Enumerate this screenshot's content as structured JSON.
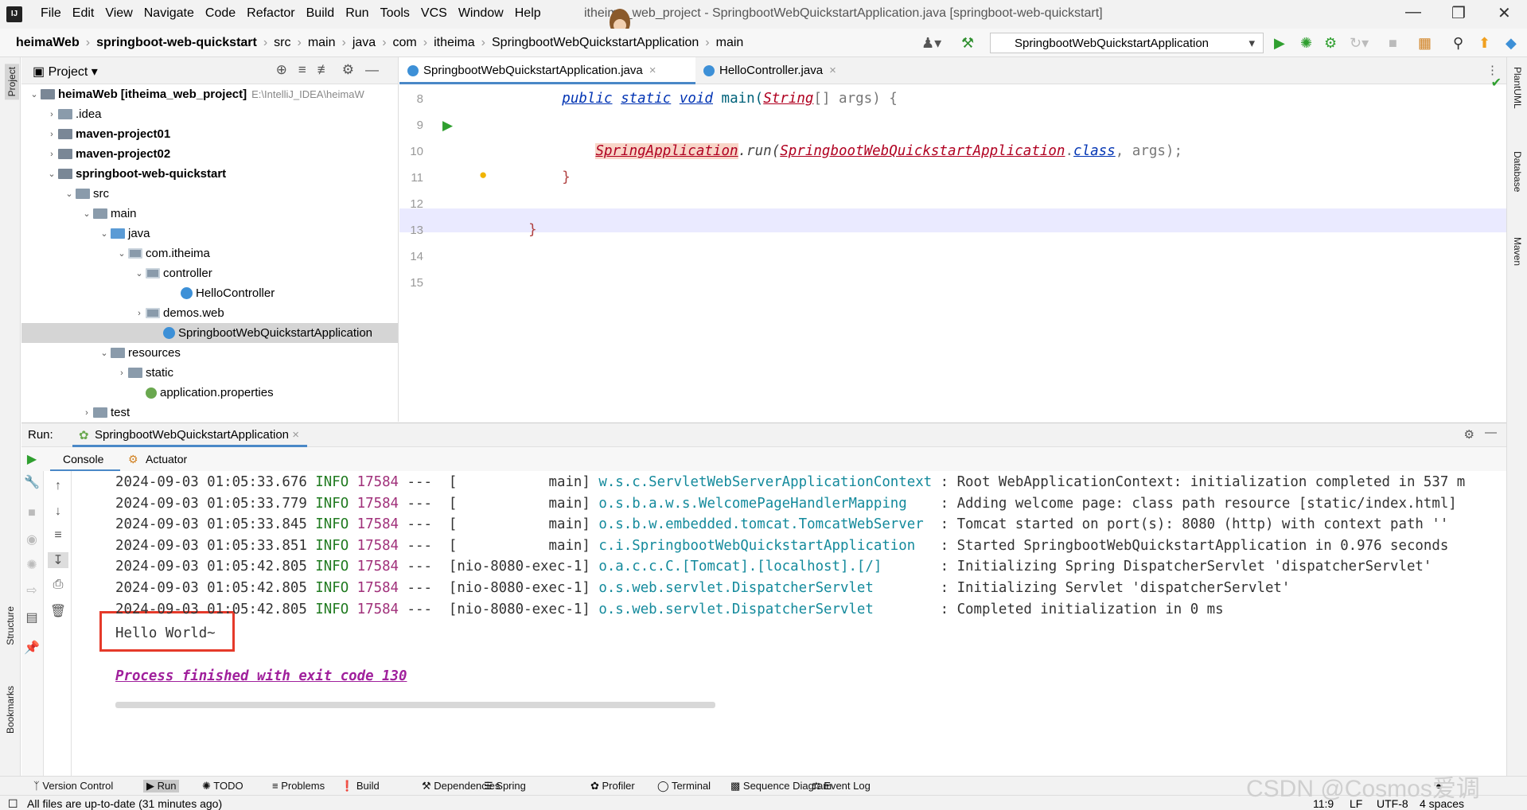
{
  "menubar": {
    "items": [
      "File",
      "Edit",
      "View",
      "Navigate",
      "Code",
      "Refactor",
      "Build",
      "Run",
      "Tools",
      "VCS",
      "Window",
      "Help"
    ],
    "window_title": "itheima_web_project - SpringbootWebQuickstartApplication.java [springboot-web-quickstart]"
  },
  "navbar": {
    "crumbs": [
      "heimaWeb",
      "springboot-web-quickstart",
      "src",
      "main",
      "java",
      "com",
      "itheima",
      "SpringbootWebQuickstartApplication",
      "main"
    ],
    "run_config": "SpringbootWebQuickstartApplication"
  },
  "project": {
    "title": "Project",
    "tree": [
      {
        "label": "heimaWeb",
        "extra": "[itheima_web_project]",
        "path": "E:\\IntelliJ_IDEA\\heimaW",
        "depth": 0,
        "arrow": "open",
        "icon": "mod",
        "bold": false
      },
      {
        "label": ".idea",
        "depth": 1,
        "arrow": "closed",
        "icon": "folder"
      },
      {
        "label": "maven-project01",
        "depth": 1,
        "arrow": "closed",
        "icon": "mod",
        "bold": true
      },
      {
        "label": "maven-project02",
        "depth": 1,
        "arrow": "closed",
        "icon": "mod",
        "bold": true
      },
      {
        "label": "springboot-web-quickstart",
        "depth": 1,
        "arrow": "open",
        "icon": "mod",
        "bold": true
      },
      {
        "label": "src",
        "depth": 2,
        "arrow": "open",
        "icon": "folder"
      },
      {
        "label": "main",
        "depth": 3,
        "arrow": "open",
        "icon": "folder"
      },
      {
        "label": "java",
        "depth": 4,
        "arrow": "open",
        "icon": "folderblue"
      },
      {
        "label": "com.itheima",
        "depth": 5,
        "arrow": "open",
        "icon": "pkg"
      },
      {
        "label": "controller",
        "depth": 6,
        "arrow": "open",
        "icon": "pkg"
      },
      {
        "label": "HelloController",
        "depth": 8,
        "arrow": "",
        "icon": "cls"
      },
      {
        "label": "demos.web",
        "depth": 6,
        "arrow": "closed",
        "icon": "pkg"
      },
      {
        "label": "SpringbootWebQuickstartApplication",
        "depth": 7,
        "arrow": "",
        "icon": "cls",
        "selected": true
      },
      {
        "label": "resources",
        "depth": 4,
        "arrow": "open",
        "icon": "folder"
      },
      {
        "label": "static",
        "depth": 5,
        "arrow": "closed",
        "icon": "folder"
      },
      {
        "label": "application.properties",
        "depth": 6,
        "arrow": "",
        "icon": "prop"
      },
      {
        "label": "test",
        "depth": 3,
        "arrow": "closed",
        "icon": "folder"
      }
    ]
  },
  "editor": {
    "tabs": [
      "SpringbootWebQuickstartApplication.java",
      "HelloController.java"
    ],
    "line_numbers": [
      "8",
      "9",
      "10",
      "11",
      "12",
      "13",
      "14",
      "15"
    ],
    "code": {
      "l9_public": "public",
      "l9_static": "static",
      "l9_void": "void",
      "l9_main": "main(",
      "l9_string": "String",
      "l9_rest": "[] args) {",
      "l11_app": "SpringApplication",
      "l11_run": ".run(",
      "l11_cls": "SpringbootWebQuickstartApplication",
      "l11_dot": ".",
      "l11_class": "class",
      "l11_args": ", args);",
      "l12": "}",
      "l14": "}"
    }
  },
  "run": {
    "label": "Run:",
    "tab": "SpringbootWebQuickstartApplication",
    "subtabs": [
      "Console",
      "Actuator"
    ],
    "log": [
      {
        "ts": "2024-09-03 01:05:33.676",
        "level": "INFO",
        "pid": "17584",
        "thread": "---  [           main]",
        "logger": "w.s.c.ServletWebServerApplicationContext",
        "msg": " : Root WebApplicationContext: initialization completed in 537 m"
      },
      {
        "ts": "2024-09-03 01:05:33.779",
        "level": "INFO",
        "pid": "17584",
        "thread": "---  [           main]",
        "logger": "o.s.b.a.w.s.WelcomePageHandlerMapping   ",
        "msg": " : Adding welcome page: class path resource [static/index.html]"
      },
      {
        "ts": "2024-09-03 01:05:33.845",
        "level": "INFO",
        "pid": "17584",
        "thread": "---  [           main]",
        "logger": "o.s.b.w.embedded.tomcat.TomcatWebServer ",
        "msg": " : Tomcat started on port(s): 8080 (http) with context path ''"
      },
      {
        "ts": "2024-09-03 01:05:33.851",
        "level": "INFO",
        "pid": "17584",
        "thread": "---  [           main]",
        "logger": "c.i.SpringbootWebQuickstartApplication  ",
        "msg": " : Started SpringbootWebQuickstartApplication in 0.976 seconds"
      },
      {
        "ts": "2024-09-03 01:05:42.805",
        "level": "INFO",
        "pid": "17584",
        "thread": "---  [nio-8080-exec-1]",
        "logger": "o.a.c.c.C.[Tomcat].[localhost].[/]      ",
        "msg": " : Initializing Spring DispatcherServlet 'dispatcherServlet'"
      },
      {
        "ts": "2024-09-03 01:05:42.805",
        "level": "INFO",
        "pid": "17584",
        "thread": "---  [nio-8080-exec-1]",
        "logger": "o.s.web.servlet.DispatcherServlet       ",
        "msg": " : Initializing Servlet 'dispatcherServlet'"
      },
      {
        "ts": "2024-09-03 01:05:42.805",
        "level": "INFO",
        "pid": "17584",
        "thread": "---  [nio-8080-exec-1]",
        "logger": "o.s.web.servlet.DispatcherServlet       ",
        "msg": " : Completed initialization in 0 ms"
      }
    ],
    "hello": "Hello World~",
    "exit": "Process finished with exit code 130"
  },
  "toolwindows": [
    "Version Control",
    "Run",
    "TODO",
    "Problems",
    "Build",
    "Dependencies",
    "Spring",
    "Profiler",
    "Terminal",
    "Sequence Diagram",
    "Event Log"
  ],
  "sidebars": {
    "left": [
      "Project",
      "Structure",
      "Bookmarks"
    ],
    "right": [
      "PlantUML",
      "Database",
      "Maven"
    ]
  },
  "status": {
    "message": "All files are up-to-date (31 minutes ago)",
    "position": "11:9",
    "line_sep": "LF",
    "encoding": "UTF-8",
    "indent": "4 spaces"
  },
  "watermark": "CSDN @Cosmos爱调",
  "colors": {
    "accent": "#4a88c7",
    "highlight_box": "#e53a2a",
    "exit_text": "#a0209c"
  }
}
